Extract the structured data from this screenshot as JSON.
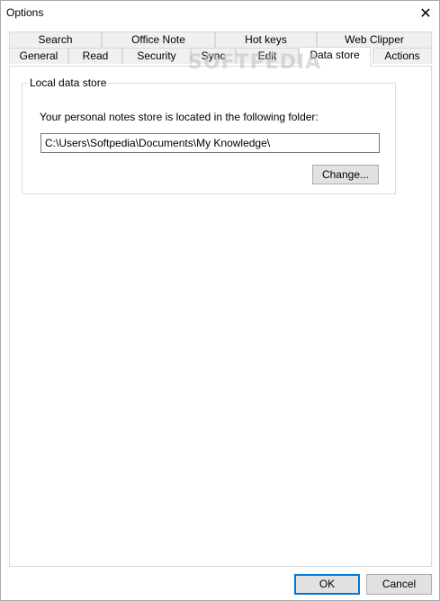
{
  "window": {
    "title": "Options"
  },
  "tabs": {
    "row_back": [
      "Search",
      "Office Note",
      "Hot keys",
      "Web Clipper"
    ],
    "row_front": [
      "General",
      "Read",
      "Security",
      "Sync",
      "Edit",
      "Data store",
      "Actions"
    ],
    "active": "Data store"
  },
  "local_store": {
    "legend": "Local data store",
    "description": "Your personal notes store is located in the following folder:",
    "path": "C:\\Users\\Softpedia\\Documents\\My Knowledge\\",
    "change_label": "Change..."
  },
  "footer": {
    "ok_label": "OK",
    "cancel_label": "Cancel"
  },
  "watermark": "SOFTPEDIA"
}
